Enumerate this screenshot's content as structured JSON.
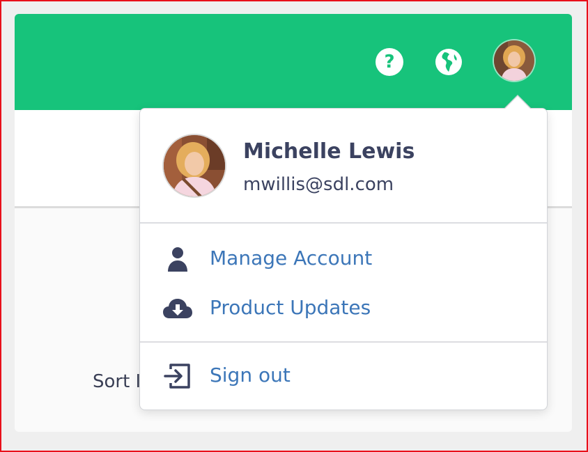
{
  "header": {
    "help_icon": "question-circle-icon",
    "language_icon": "globe-icon",
    "avatar_icon": "user-avatar"
  },
  "background": {
    "sort_label": "Sort I"
  },
  "user_menu": {
    "name": "Michelle Lewis",
    "email": "mwillis@sdl.com",
    "items": [
      {
        "label": "Manage Account",
        "icon": "user-icon"
      },
      {
        "label": "Product Updates",
        "icon": "cloud-download-icon"
      },
      {
        "label": "Sign out",
        "icon": "sign-out-icon"
      }
    ]
  },
  "colors": {
    "brand_green": "#17c37b",
    "link_blue": "#3c76b8",
    "text_dark": "#3b4260",
    "frame_red": "#e8101a"
  }
}
